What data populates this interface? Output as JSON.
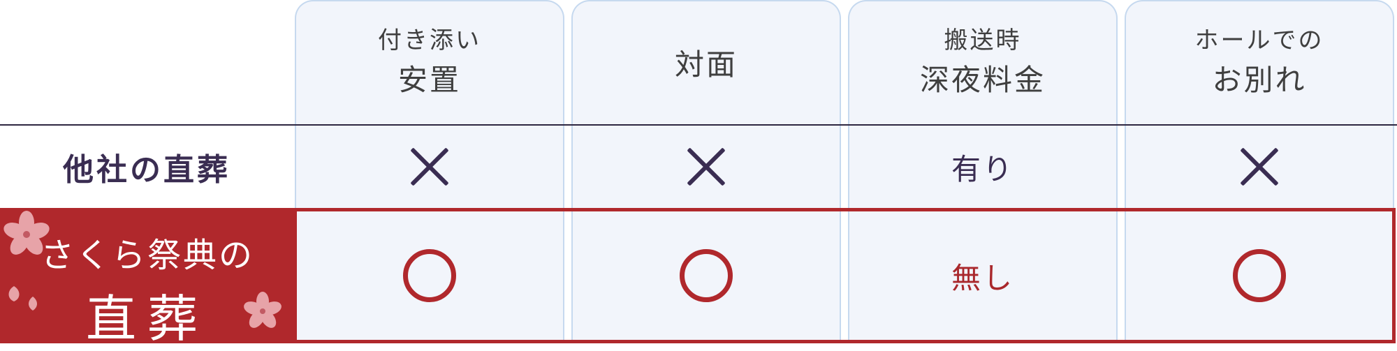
{
  "columns": [
    {
      "line1": "付き添い",
      "line2": "安置"
    },
    {
      "line1": "",
      "line2": "対面"
    },
    {
      "line1": "搬送時",
      "line2": "深夜料金"
    },
    {
      "line1": "ホールでの",
      "line2": "お別れ"
    }
  ],
  "competitor": {
    "label": "他社の直葬",
    "values": [
      "cross",
      "cross",
      "有り",
      "cross"
    ]
  },
  "ours": {
    "label_line1": "さくら祭典の",
    "label_line2": "直葬",
    "values": [
      "circle",
      "circle",
      "無し",
      "circle"
    ]
  },
  "colors": {
    "accent_red": "#b0282c",
    "navy": "#3a2d52",
    "column_bg": "#f2f5fb",
    "column_border": "#c6d9ef"
  },
  "icons": [
    "cross-icon",
    "circle-icon",
    "sakura-icon"
  ]
}
